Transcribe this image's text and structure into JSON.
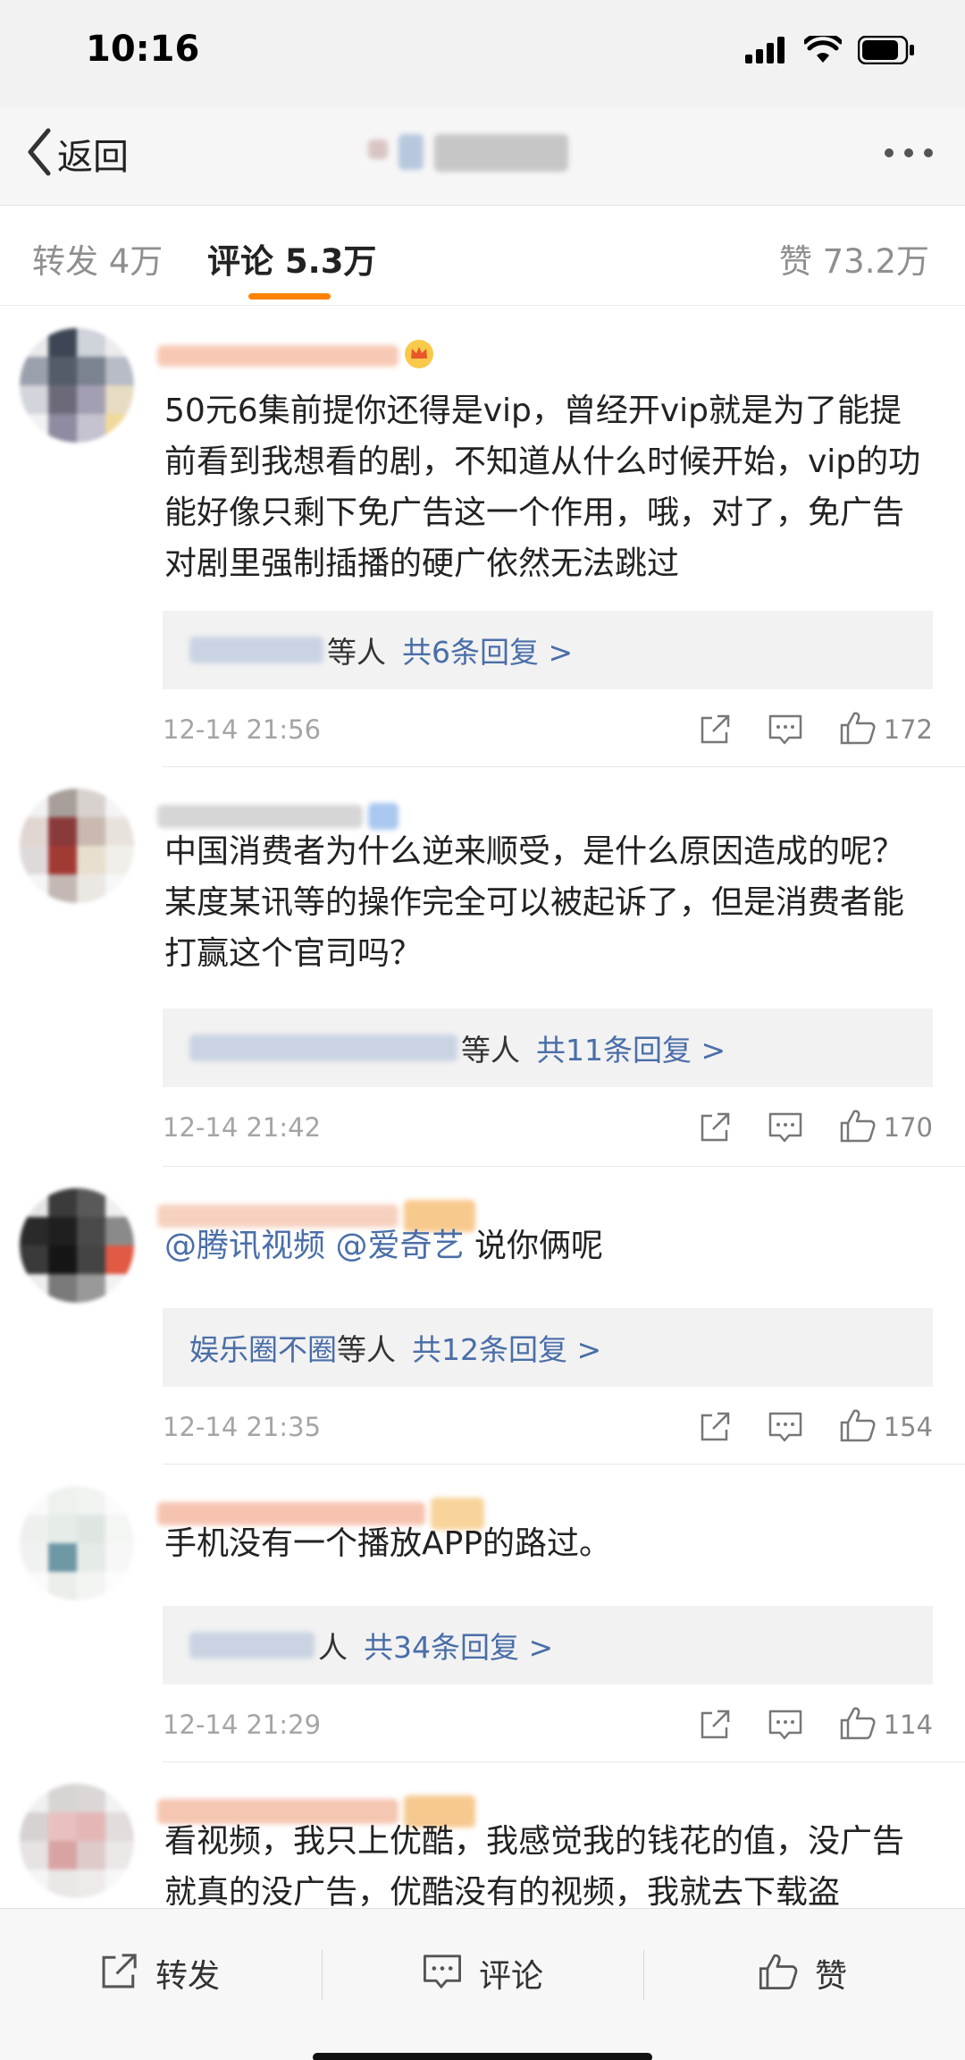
{
  "status_bar": {
    "time": "10:16"
  },
  "nav": {
    "back_label": "返回"
  },
  "tabs": {
    "repost_label": "转发",
    "repost_count": "4万",
    "comment_label": "评论",
    "comment_count": "5.3万",
    "like_label": "赞",
    "like_count": "73.2万"
  },
  "colors": {
    "accent": "#ff8200",
    "link": "#4a6ea8",
    "text": "#222222",
    "muted": "#a5a5a5"
  },
  "comments": [
    {
      "text": "50元6集前提你还得是vip，曾经开vip就是为了能提前看到我想看的剧，不知道从什么时候开始，vip的功能好像只剩下免广告这一个作用，哦，对了，免广告对剧里强制插播的硬广依然无法跳过",
      "reply_etal": "等人",
      "reply_count": "共6条回复 >",
      "time": "12-14 21:56",
      "likes": "172"
    },
    {
      "text": "中国消费者为什么逆来顺受，是什么原因造成的呢？某度某讯等的操作完全可以被起诉了，但是消费者能打赢这个官司吗？",
      "reply_etal": "等人",
      "reply_count": "共11条回复 >",
      "time": "12-14 21:42",
      "likes": "170"
    },
    {
      "mention_1": "@腾讯视频",
      "mention_2": "@爱奇艺",
      "text": "说你俩呢",
      "reply_names": "娱乐圈不圈",
      "reply_etal": "等人",
      "reply_count": "共12条回复 >",
      "time": "12-14 21:35",
      "likes": "154"
    },
    {
      "text": "手机没有一个播放APP的路过。",
      "reply_etal": "人",
      "reply_count": "共34条回复 >",
      "time": "12-14 21:29",
      "likes": "114"
    },
    {
      "text": "看视频，我只上优酷，我感觉我的钱花的值，没广告就真的没广告，优酷没有的视频，我就去下载盗"
    }
  ],
  "bottom_bar": {
    "repost": "转发",
    "comment": "评论",
    "like": "赞"
  }
}
